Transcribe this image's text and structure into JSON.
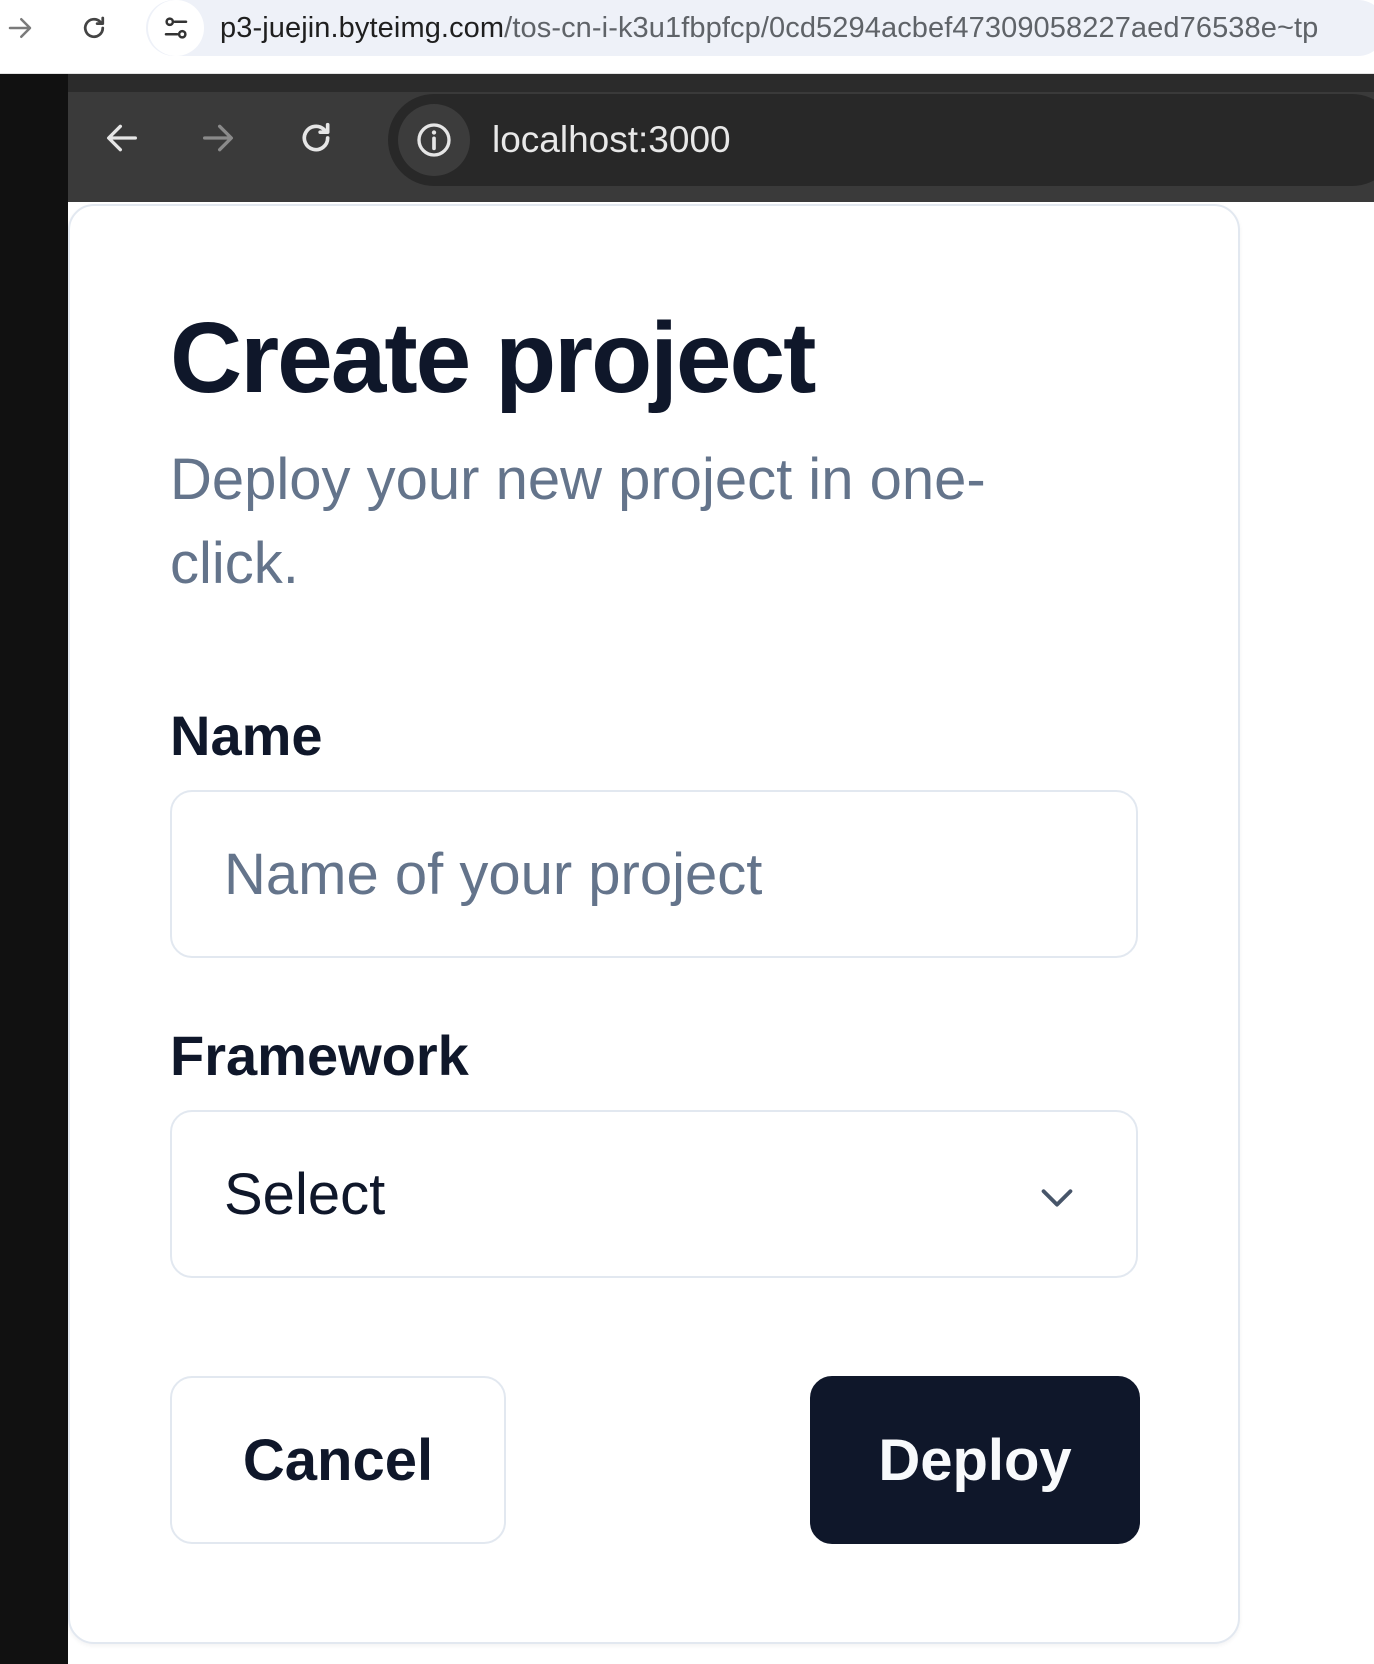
{
  "outer_browser": {
    "url_host": "p3-juejin.byteimg.com",
    "url_path": "/tos-cn-i-k3u1fbpfcp/0cd5294acbef47309058227aed76538e~tp"
  },
  "inner_browser": {
    "url": "localhost:3000"
  },
  "form": {
    "title": "Create project",
    "description": "Deploy your new project in one-click.",
    "name_label": "Name",
    "name_placeholder": "Name of your project",
    "name_value": "",
    "framework_label": "Framework",
    "framework_selected": "Select",
    "cancel_label": "Cancel",
    "deploy_label": "Deploy"
  },
  "colors": {
    "primary": "#0f172a",
    "muted_text": "#64748b",
    "border": "#e2e8f0"
  }
}
